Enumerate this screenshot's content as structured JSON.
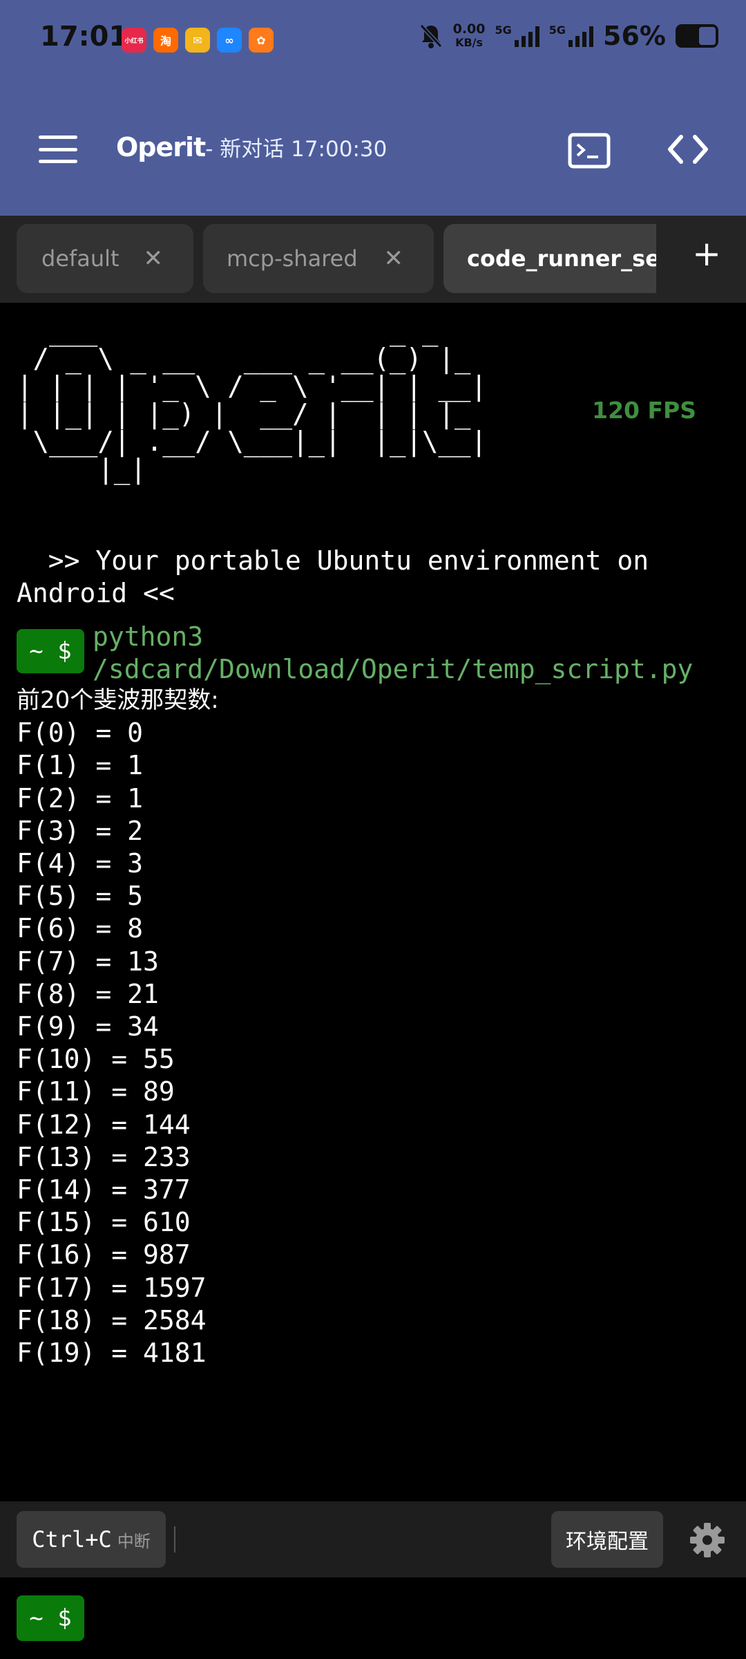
{
  "status_bar": {
    "time": "17:01",
    "net_speed_value": "0.00",
    "net_speed_unit": "KB/s",
    "net_type_1": "5G",
    "net_type_2": "5G",
    "battery_percent": "56%",
    "battery_level": 0.56,
    "notification_apps": [
      {
        "icon": "xiaohongshu-icon",
        "glyph": "小红书",
        "color": "#e6294b"
      },
      {
        "icon": "taobao-icon",
        "glyph": "淘",
        "color": "#ff6a00"
      },
      {
        "icon": "mail-icon",
        "glyph": "✉",
        "color": "#f2b51c"
      },
      {
        "icon": "link-app-icon",
        "glyph": "∞",
        "color": "#1e86ff"
      },
      {
        "icon": "delivery-app-icon",
        "glyph": "✿",
        "color": "#ff7a1a"
      }
    ]
  },
  "header": {
    "app_name": "Operit",
    "subtitle": "- 新对话 17:00:30"
  },
  "tabs": [
    {
      "label": "default",
      "close": "✕"
    },
    {
      "label": "mcp-shared",
      "close": "✕"
    },
    {
      "label": "code_runner_session",
      "active": true
    }
  ],
  "add_tab_label": "+",
  "terminal": {
    "fps": "120 FPS",
    "ascii_banner": "  ___                  _ _\n / _ \\ _ __   ___ _ __(_) |_\n| | | | '_ \\ / _ \\ '__| | __|\n| |_| | |_) |  __/ |  | | |_\n \\___/| .__/ \\___|_|  |_|\\__|\n     |_|",
    "tagline": "  >> Your portable Ubuntu environment on Android <<",
    "prompt": "~ $",
    "command": "python3 /sdcard/Download/Operit/temp_script.py",
    "output_heading": "前20个斐波那契数:",
    "output_lines": [
      "F(0) = 0",
      "F(1) = 1",
      "F(2) = 1",
      "F(3) = 2",
      "F(4) = 3",
      "F(5) = 5",
      "F(6) = 8",
      "F(7) = 13",
      "F(8) = 21",
      "F(9) = 34",
      "F(10) = 55",
      "F(11) = 89",
      "F(12) = 144",
      "F(13) = 233",
      "F(14) = 377",
      "F(15) = 610",
      "F(16) = 987",
      "F(17) = 1597",
      "F(18) = 2584",
      "F(19) = 4181"
    ]
  },
  "toolbar": {
    "ctrl_c_key": "Ctrl+C",
    "ctrl_c_hint": "中断",
    "env_config": "环境配置"
  },
  "input": {
    "prompt": "~ $"
  }
}
